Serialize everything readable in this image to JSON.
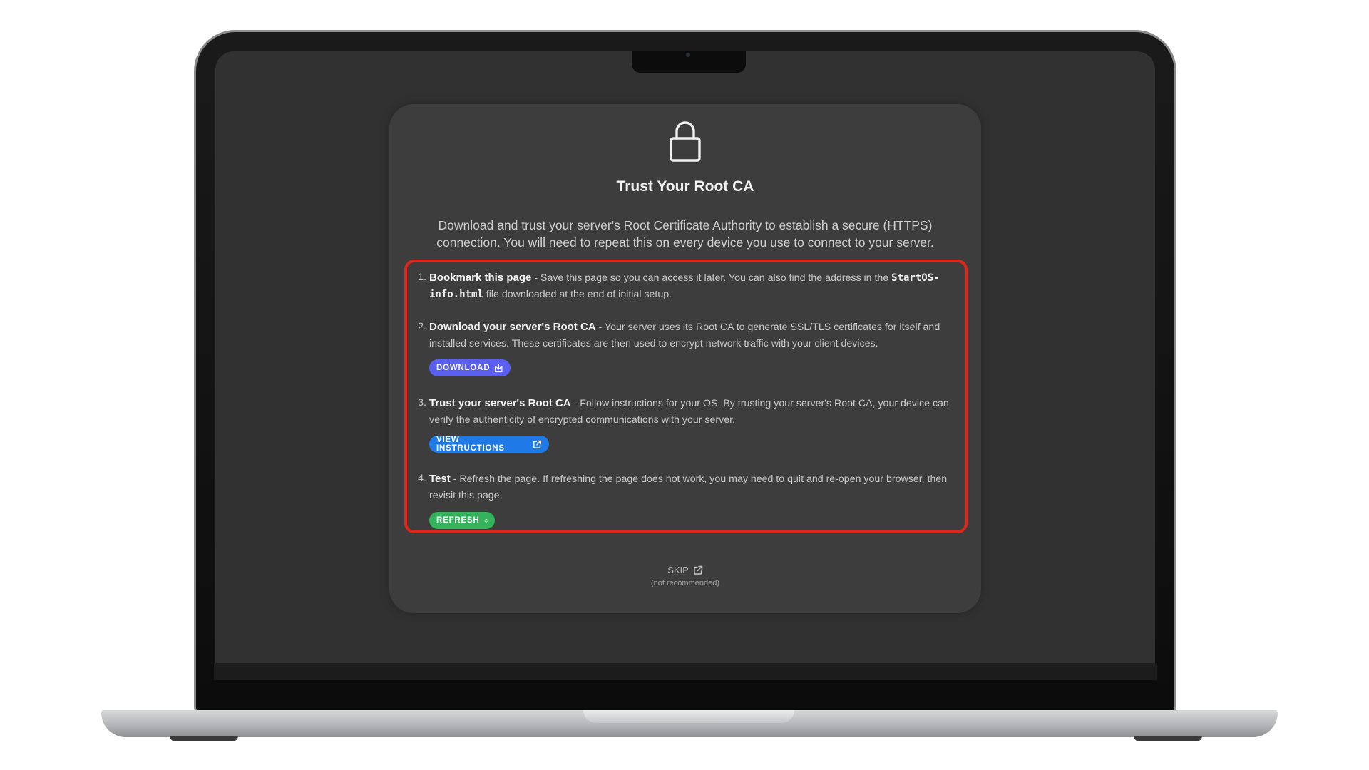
{
  "card": {
    "title": "Trust Your Root CA",
    "intro": "Download and trust your server's Root Certificate Authority to establish a secure (HTTPS) connection. You will need to repeat this on every device you use to connect to your server."
  },
  "steps": [
    {
      "number": "1.",
      "heading": "Bookmark this page",
      "text_a": " - Save this page so you can access it later. You can also find the address in the ",
      "code": "StartOS-info.html",
      "text_b": " file downloaded at the end of initial setup."
    },
    {
      "number": "2.",
      "heading": "Download your server's Root CA",
      "text": " - Your server uses its Root CA to generate SSL/TLS certificates for itself and installed services. These certificates are then used to encrypt network traffic with your client devices.",
      "button_label": "DOWNLOAD"
    },
    {
      "number": "3.",
      "heading": "Trust your server's Root CA",
      "text": " - Follow instructions for your OS. By trusting your server's Root CA, your device can verify the authenticity of encrypted communications with your server.",
      "button_label": "VIEW INSTRUCTIONS"
    },
    {
      "number": "4.",
      "heading": "Test",
      "text": " - Refresh the page. If refreshing the page does not work, you may need to quit and re-open your browser, then revisit this page.",
      "button_label": "REFRESH"
    }
  ],
  "skip": {
    "label": "SKIP",
    "note": "(not recommended)"
  },
  "icons": {
    "lock": "lock-icon",
    "download": "download-icon",
    "external": "external-link-icon",
    "refresh": "refresh-icon"
  },
  "colors": {
    "screen_bg": "#313131",
    "card_bg": "#3d3d3d",
    "highlight_border": "#e0261b",
    "download_button": "#5a5ff0",
    "instructions_button": "#1f7ae8",
    "refresh_button": "#33b35b"
  }
}
